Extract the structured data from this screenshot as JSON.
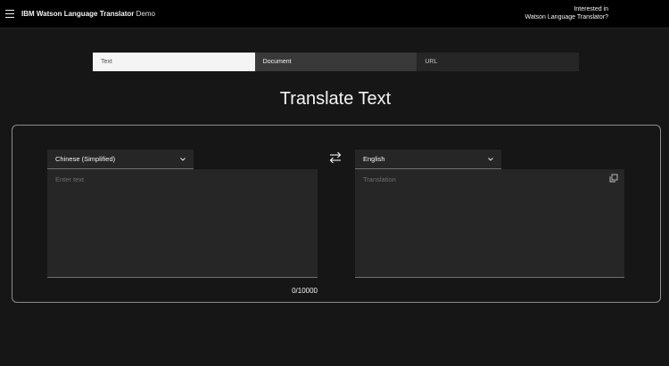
{
  "header": {
    "brand_strong": "IBM Watson Language Translator",
    "brand_light": "Demo",
    "interest_line1": "Interested in",
    "interest_line2": "Watson Language Translator?"
  },
  "tabs": [
    {
      "label": "Text",
      "active": true
    },
    {
      "label": "Document",
      "active": false
    },
    {
      "label": "URL",
      "active": false
    }
  ],
  "page": {
    "title": "Translate Text"
  },
  "source": {
    "language": "Chinese (Simplified)",
    "placeholder": "Enter text",
    "value": "",
    "counter": "0/10000"
  },
  "target": {
    "language": "English",
    "placeholder": "Translation"
  },
  "icons": {
    "menu": "hamburger-icon",
    "swap": "swap-arrows-icon",
    "chevron": "chevron-down-icon",
    "copy": "copy-icon"
  },
  "colors": {
    "background": "#161616",
    "header": "#000000",
    "field": "#262626",
    "active_tab": "#f4f4f4",
    "text": "#f4f4f4",
    "placeholder": "#6f6f6f"
  }
}
